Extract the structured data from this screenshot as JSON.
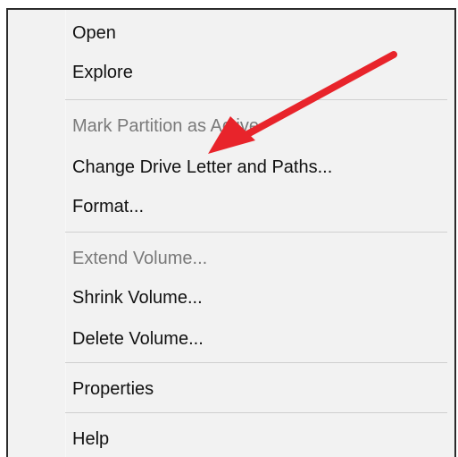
{
  "context_menu": {
    "items": [
      {
        "label": "Open",
        "enabled": true
      },
      {
        "label": "Explore",
        "enabled": true
      },
      {
        "label": "Mark Partition as Active",
        "enabled": false
      },
      {
        "label": "Change Drive Letter and Paths...",
        "enabled": true
      },
      {
        "label": "Format...",
        "enabled": true
      },
      {
        "label": "Extend Volume...",
        "enabled": false
      },
      {
        "label": "Shrink Volume...",
        "enabled": true
      },
      {
        "label": "Delete Volume...",
        "enabled": true
      },
      {
        "label": "Properties",
        "enabled": true
      },
      {
        "label": "Help",
        "enabled": true
      }
    ]
  },
  "annotation": {
    "arrow_color": "#e8242b"
  }
}
